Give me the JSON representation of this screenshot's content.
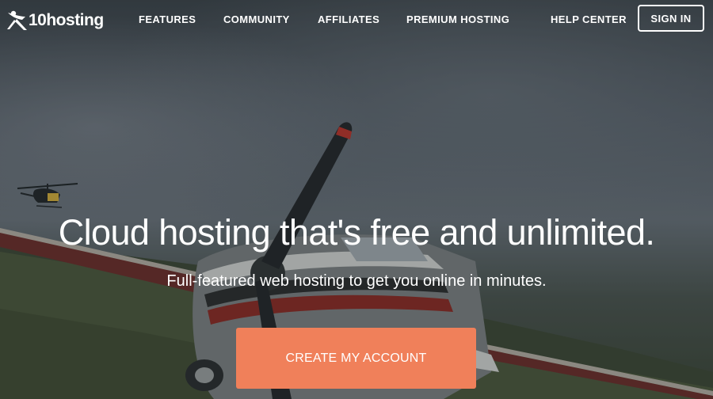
{
  "brand": {
    "logo_text": "10hosting",
    "logo_mark": "x-figure-logo"
  },
  "nav": {
    "items": [
      {
        "label": "FEATURES"
      },
      {
        "label": "COMMUNITY"
      },
      {
        "label": "AFFILIATES"
      },
      {
        "label": "PREMIUM HOSTING"
      },
      {
        "label": "HELP CENTER"
      }
    ],
    "signin_label": "SIGN IN"
  },
  "hero": {
    "headline": "Cloud hosting that's free and unlimited.",
    "subheadline": "Full-featured web hosting to get you online in minutes.",
    "cta_label": "CREATE MY ACCOUNT",
    "background": "stormy-sky-airfield-with-propeller-plane-and-helicopter"
  },
  "colors": {
    "cta": "#f0805a",
    "text": "#ffffff",
    "sky": "#56606a"
  }
}
